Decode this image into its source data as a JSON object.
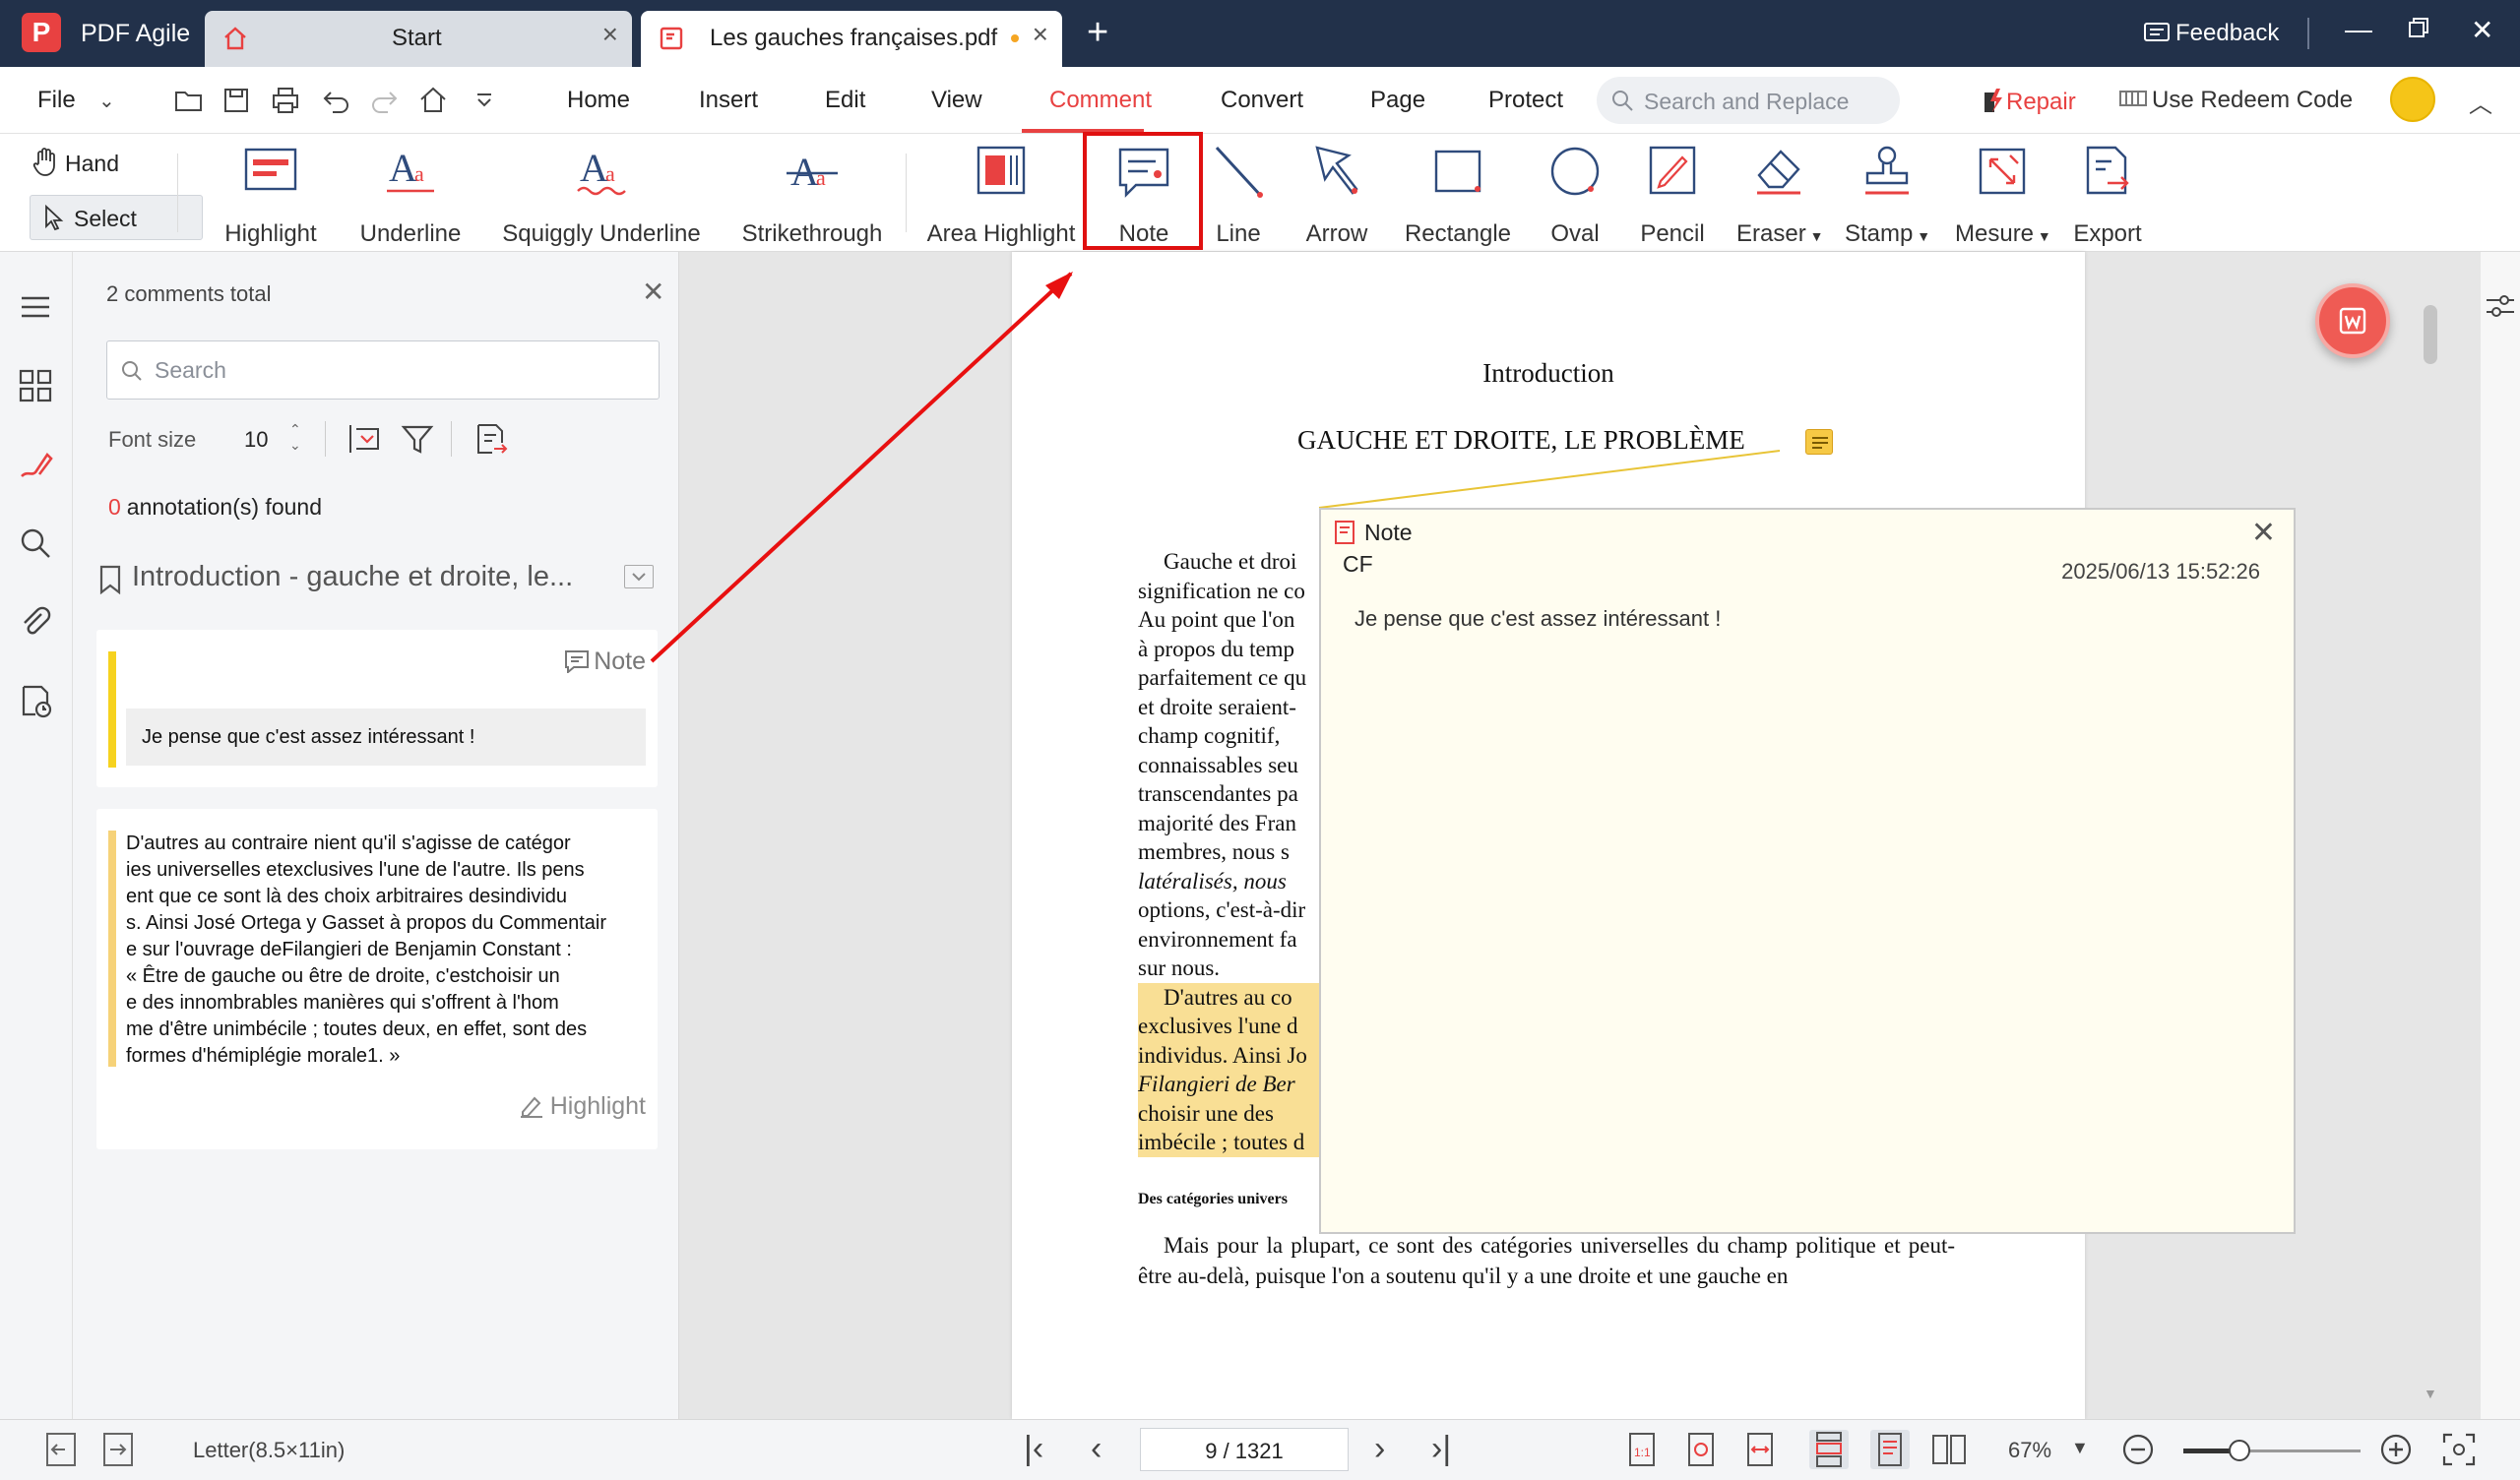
{
  "titlebar": {
    "app_name": "PDF Agile",
    "tabs": [
      {
        "label": "Start"
      },
      {
        "label": "Les gauches françaises.pdf"
      }
    ],
    "feedback": "Feedback"
  },
  "menubar": {
    "file": "File",
    "tabs": [
      "Home",
      "Insert",
      "Edit",
      "View",
      "Comment",
      "Convert",
      "Page",
      "Protect"
    ],
    "active_tab": "Comment",
    "search_placeholder": "Search and Replace",
    "repair": "Repair",
    "redeem": "Use Redeem Code"
  },
  "toolbar": {
    "hand": "Hand",
    "select": "Select",
    "tools": [
      "Highlight",
      "Underline",
      "Squiggly Underline",
      "Strikethrough",
      "Area Highlight",
      "Note",
      "Line",
      "Arrow",
      "Rectangle",
      "Oval",
      "Pencil",
      "Eraser",
      "Stamp",
      "Mesure",
      "Export"
    ]
  },
  "panel": {
    "count": "2 comments total",
    "search_placeholder": "Search",
    "font_size_label": "Font size",
    "font_size_value": "10",
    "found_count": "0",
    "found_label": "annotation(s) found",
    "section_title": "Introduction - gauche et droite, le...",
    "note_card": {
      "type": "Note",
      "content": "Je pense que c'est assez intéressant !"
    },
    "highlight_card": {
      "type": "Highlight",
      "lines": [
        "D'autres au contraire nient qu'il s'agisse de catégor",
        "ies universelles etexclusives l'une de l'autre. Ils pens",
        "ent que ce sont là des choix arbitraires desindividu",
        "s. Ainsi José Ortega y Gasset à propos du Commentair",
        "e sur l'ouvrage deFilangieri de Benjamin Constant :",
        "« Être de gauche ou être de droite, c'estchoisir un",
        "e des innombrables manières qui s'offrent à l'hom",
        "me d'être unimbécile ; toutes deux, en effet, sont des",
        "formes d'hémiplégie morale1. »"
      ]
    }
  },
  "document": {
    "title": "Introduction",
    "subtitle": "GAUCHE ET DROITE, LE PROBLÈME",
    "lines": [
      "Gauche et droi",
      "signification ne co",
      "Au point que l'on",
      "à propos du temp",
      "parfaitement ce qu",
      "et droite seraient-",
      "champ cognitif,",
      "connaissables seu",
      "transcendantes pa",
      "majorité des Fran",
      "membres, nous s",
      "latéralisés, nous",
      "options, c'est-à-dir",
      "environnement fa",
      "sur nous."
    ],
    "hl_lines": [
      "D'autres au co",
      "exclusives l'une d",
      "individus. Ainsi Jo",
      "Filangieri de Ber",
      "choisir une des",
      "imbécile ; toutes d"
    ],
    "heading": "Des catégories univers",
    "final_text": "Mais pour la plupart, ce sont des catégories universelles du champ politique et peut-être au-delà, puisque l'on a soutenu qu'il y a une droite et une gauche en"
  },
  "popup": {
    "title": "Note",
    "author": "CF",
    "date": "2025/06/13 15:52:26",
    "text": "Je pense que c'est assez intéressant !"
  },
  "statusbar": {
    "paper": "Letter(8.5×11in)",
    "page": "9 / 1321",
    "zoom": "67%",
    "zoom_level": 0.32
  },
  "colors": {
    "titlebar": "#22314a",
    "accent": "#e84141",
    "note_bar": "#f6d21f",
    "highlight": "#f9df95"
  }
}
